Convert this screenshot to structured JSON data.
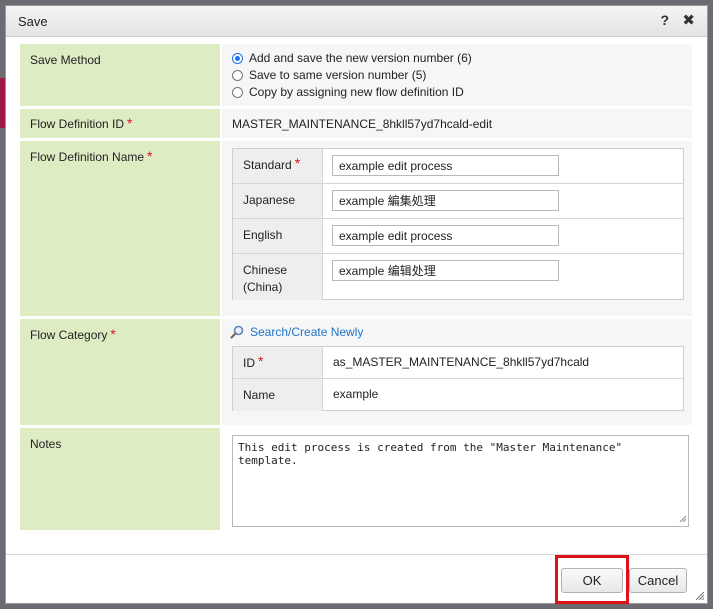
{
  "dialog": {
    "title": "Save",
    "help_glyph": "?",
    "close_glyph": "✖"
  },
  "save_method": {
    "label": "Save Method",
    "options": [
      {
        "label": "Add and save the new version number (6)",
        "checked": true
      },
      {
        "label": "Save to same version number (5)",
        "checked": false
      },
      {
        "label": "Copy by assigning new flow definition ID",
        "checked": false
      }
    ]
  },
  "flow_definition_id": {
    "label": "Flow Definition ID",
    "required_mark": "*",
    "value": "MASTER_MAINTENANCE_8hkll57yd7hcald-edit"
  },
  "flow_definition_name": {
    "label": "Flow Definition Name",
    "required_mark": "*",
    "rows": [
      {
        "label": "Standard",
        "required_mark": "*",
        "value": "example edit process"
      },
      {
        "label": "Japanese",
        "value": "example 編集処理"
      },
      {
        "label": "English",
        "value": "example edit process"
      },
      {
        "label": "Chinese (China)",
        "value": "example 编辑处理"
      }
    ]
  },
  "flow_category": {
    "label": "Flow Category",
    "required_mark": "*",
    "search_link": "Search/Create Newly",
    "search_icon": "magnifier-icon",
    "id_label": "ID",
    "id_required_mark": "*",
    "id_value": "as_MASTER_MAINTENANCE_8hkll57yd7hcald",
    "name_label": "Name",
    "name_value": "example"
  },
  "notes": {
    "label": "Notes",
    "value": "This edit process is created from the \"Master Maintenance\" template."
  },
  "footer": {
    "ok_label": "OK",
    "cancel_label": "Cancel"
  },
  "colors": {
    "label_bg": "#deecc4",
    "required": "#e0101a",
    "link": "#1f74c7",
    "highlight": "#e01019"
  }
}
